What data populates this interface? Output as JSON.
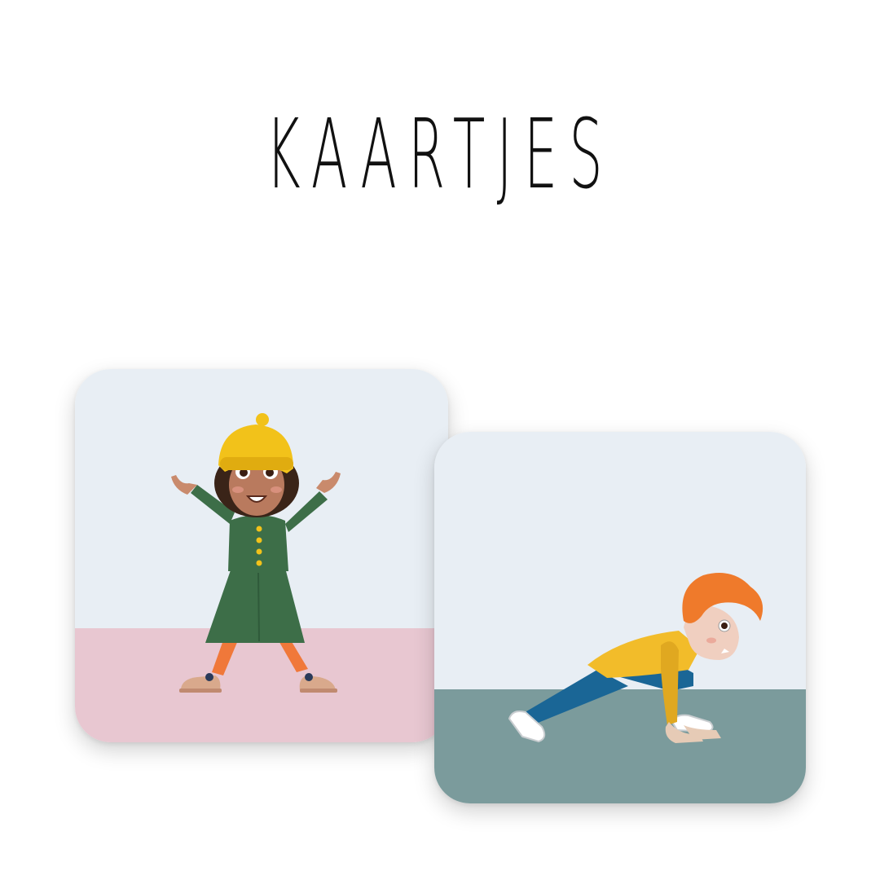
{
  "title": "KAARTJES",
  "colors": {
    "card_sky": "#e8eef4",
    "left_floor": "#e8c7d1",
    "right_floor": "#7b9b9c",
    "girl_coat": "#3d6e48",
    "girl_hat": "#f2c21a",
    "girl_legs": "#f0783a",
    "boy_hair": "#ef7a2b",
    "boy_shirt": "#f2bc2a",
    "boy_pants": "#1a6696"
  },
  "cards": [
    {
      "illustration": "girl-star-jump"
    },
    {
      "illustration": "boy-bear-crawl"
    }
  ]
}
